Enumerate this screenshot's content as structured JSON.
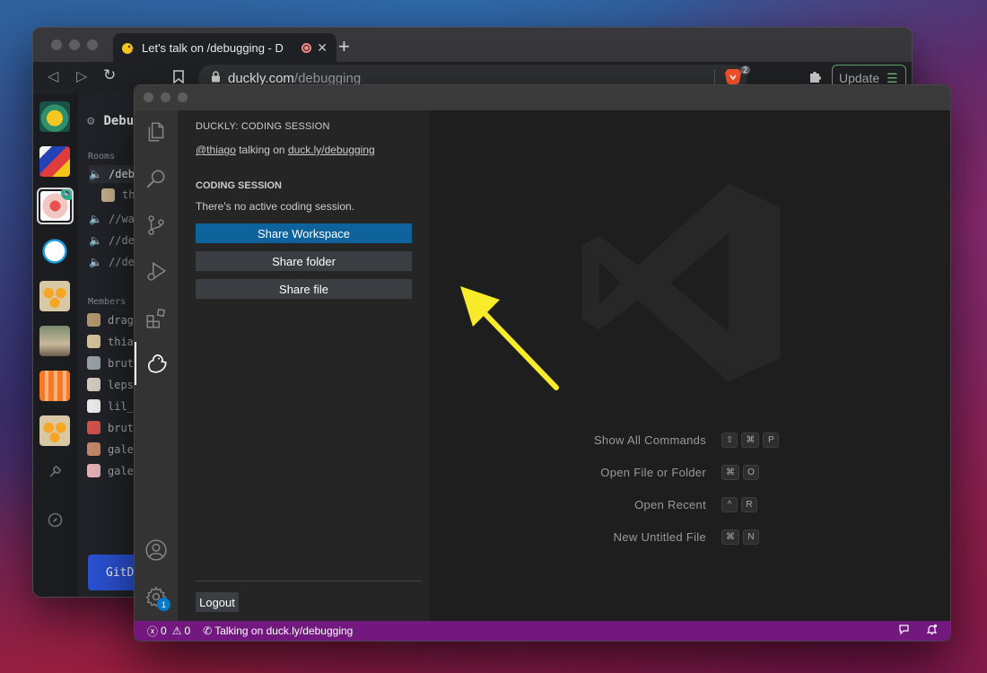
{
  "browser": {
    "tab_title": "Let's talk on /debugging - D",
    "tab_close": "✕",
    "new_tab": "+",
    "url_host": "duckly.com",
    "url_path": "/debugging",
    "shield_count": "2",
    "update_label": "Update",
    "back_icon": "◁",
    "forward_icon": "▷",
    "reload_icon": "↻"
  },
  "duckly_web": {
    "header": "Debugging",
    "rooms_label": "Rooms",
    "rooms": [
      {
        "name": "/debugging",
        "active": true
      },
      {
        "name": "thiago",
        "active": false,
        "sub": true
      },
      {
        "name": "//wa",
        "active": false
      },
      {
        "name": "//de",
        "active": false
      },
      {
        "name": "//de",
        "active": false
      }
    ],
    "members_label": "Members",
    "members": [
      "dragon",
      "thiago",
      "brut",
      "leps",
      "lil_",
      "brut",
      "gale",
      "gale"
    ],
    "github_button": "GitDu",
    "colors": {
      "accent": "#2bb585",
      "button": "#2b52d6"
    }
  },
  "vscode": {
    "sidebar_title": "DUCKLY: CODING SESSION",
    "talking_user": "@thiago",
    "talking_mid": " talking on ",
    "talking_link": "duck.ly/debugging",
    "section_title": "CODING SESSION",
    "empty_text": "There's no active coding session.",
    "buttons": {
      "share_workspace": "Share Workspace",
      "share_folder": "Share folder",
      "share_file": "Share file"
    },
    "logout": "Logout",
    "settings_badge": "1",
    "shortcuts": [
      {
        "label": "Show All Commands",
        "keys": [
          "⇧",
          "⌘",
          "P"
        ]
      },
      {
        "label": "Open File or Folder",
        "keys": [
          "⌘",
          "O"
        ]
      },
      {
        "label": "Open Recent",
        "keys": [
          "^",
          "R"
        ]
      },
      {
        "label": "New Untitled File",
        "keys": [
          "⌘",
          "N"
        ]
      }
    ],
    "status": {
      "errors": "0",
      "warnings": "0",
      "talking": "Talking on duck.ly/debugging"
    },
    "colors": {
      "status_bar": "#72187f",
      "primary_button": "#0e639c"
    }
  }
}
